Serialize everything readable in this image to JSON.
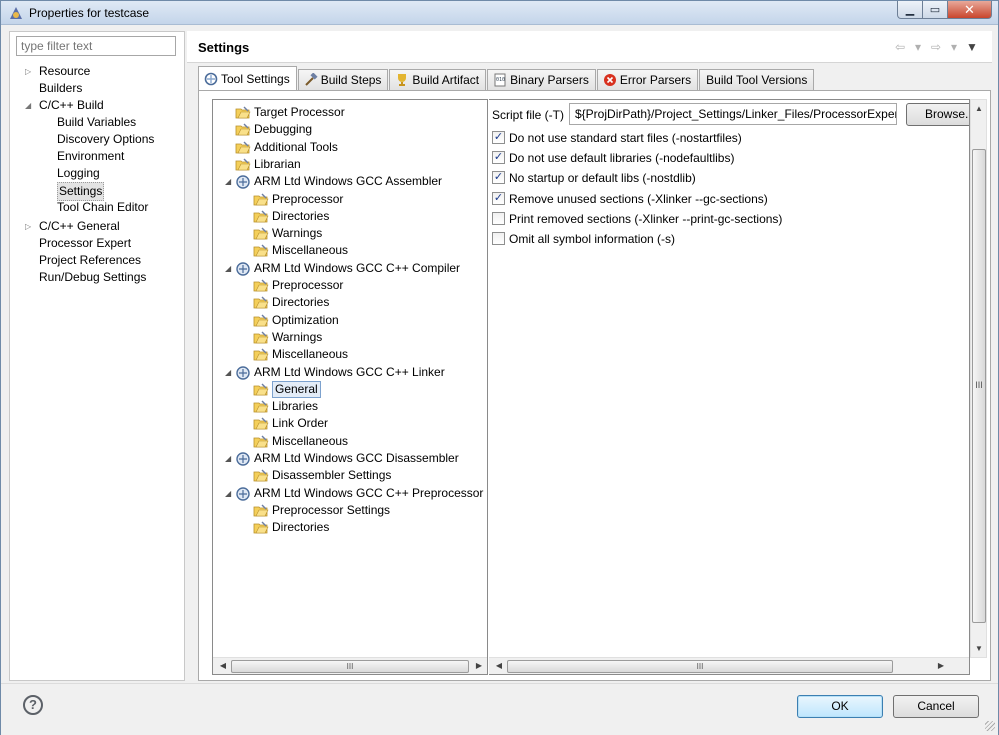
{
  "window": {
    "title": "Properties for testcase"
  },
  "filter": {
    "placeholder": "type filter text"
  },
  "nav": {
    "items": [
      {
        "label": "Resource",
        "twisty": "▷"
      },
      {
        "label": "Builders",
        "twisty": ""
      },
      {
        "label": "C/C++ Build",
        "twisty": "◢"
      },
      {
        "label": "Build Variables",
        "twisty": ""
      },
      {
        "label": "Discovery Options",
        "twisty": ""
      },
      {
        "label": "Environment",
        "twisty": ""
      },
      {
        "label": "Logging",
        "twisty": ""
      },
      {
        "label": "Settings",
        "twisty": ""
      },
      {
        "label": "Tool Chain Editor",
        "twisty": ""
      },
      {
        "label": "C/C++ General",
        "twisty": "▷"
      },
      {
        "label": "Processor Expert",
        "twisty": ""
      },
      {
        "label": "Project References",
        "twisty": ""
      },
      {
        "label": "Run/Debug Settings",
        "twisty": ""
      }
    ]
  },
  "header": {
    "title": "Settings"
  },
  "tabs": [
    {
      "label": "Tool Settings",
      "icon": "tool-settings-icon"
    },
    {
      "label": "Build Steps",
      "icon": "hammer-icon"
    },
    {
      "label": "Build Artifact",
      "icon": "trophy-icon"
    },
    {
      "label": "Binary Parsers",
      "icon": "binary-icon"
    },
    {
      "label": "Error Parsers",
      "icon": "error-icon"
    },
    {
      "label": "Build Tool Versions",
      "icon": ""
    }
  ],
  "tree": {
    "items": [
      {
        "label": "Target Processor"
      },
      {
        "label": "Debugging"
      },
      {
        "label": "Additional Tools"
      },
      {
        "label": "Librarian"
      },
      {
        "label": "ARM Ltd Windows GCC Assembler"
      },
      {
        "label": "Preprocessor"
      },
      {
        "label": "Directories"
      },
      {
        "label": "Warnings"
      },
      {
        "label": "Miscellaneous"
      },
      {
        "label": "ARM Ltd Windows GCC C++ Compiler"
      },
      {
        "label": "Preprocessor"
      },
      {
        "label": "Directories"
      },
      {
        "label": "Optimization"
      },
      {
        "label": "Warnings"
      },
      {
        "label": "Miscellaneous"
      },
      {
        "label": "ARM Ltd Windows GCC C++ Linker"
      },
      {
        "label": "General"
      },
      {
        "label": "Libraries"
      },
      {
        "label": "Link Order"
      },
      {
        "label": "Miscellaneous"
      },
      {
        "label": "ARM Ltd Windows GCC Disassembler"
      },
      {
        "label": "Disassembler Settings"
      },
      {
        "label": "ARM Ltd Windows GCC C++ Preprocessor"
      },
      {
        "label": "Preprocessor Settings"
      },
      {
        "label": "Directories"
      }
    ]
  },
  "linker_general": {
    "script_label": "Script file (-T)",
    "script_value": "${ProjDirPath}/Project_Settings/Linker_Files/ProcessorExpert.ld",
    "browse_label": "Browse...",
    "options": [
      {
        "label": "Do not use standard start files (-nostartfiles)",
        "checked": true
      },
      {
        "label": "Do not use default libraries (-nodefaultlibs)",
        "checked": true
      },
      {
        "label": "No startup or default libs (-nostdlib)",
        "checked": true
      },
      {
        "label": "Remove unused sections (-Xlinker --gc-sections)",
        "checked": true
      },
      {
        "label": "Print removed sections (-Xlinker --print-gc-sections)",
        "checked": false
      },
      {
        "label": "Omit all symbol information (-s)",
        "checked": false
      }
    ]
  },
  "buttons": {
    "ok": "OK",
    "cancel": "Cancel"
  },
  "scroll_grip": "III"
}
